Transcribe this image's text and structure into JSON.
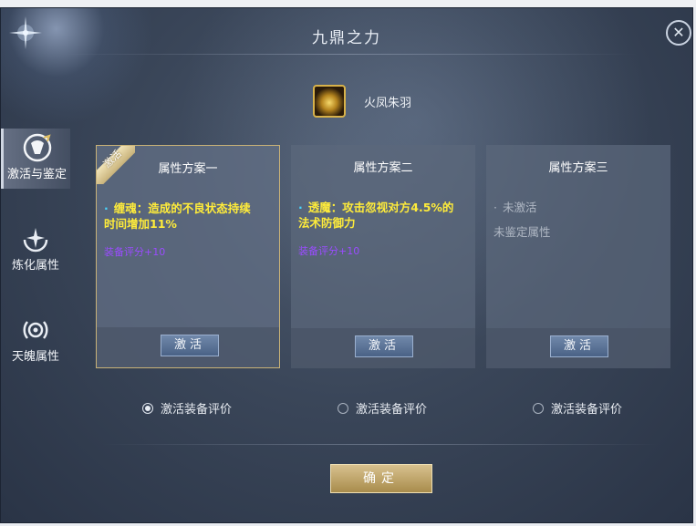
{
  "window": {
    "title": "九鼎之力"
  },
  "sidebar": {
    "items": [
      {
        "label": "激活与鉴定",
        "icon": "scroll-emblem-icon",
        "active": true
      },
      {
        "label": "炼化属性",
        "icon": "sparkle-crescent-icon",
        "active": false
      },
      {
        "label": "天魄属性",
        "icon": "eye-emblem-icon",
        "active": false
      }
    ]
  },
  "character": {
    "name": "火凤朱羽",
    "icon": "skull-portrait-icon"
  },
  "cards": [
    {
      "title": "属性方案一",
      "badge": "激活",
      "attr_line1": "缠魂：造成的不良状态持续",
      "attr_line2": "时间增加11%",
      "rating": "装备评分+10",
      "button": "激活"
    },
    {
      "title": "属性方案二",
      "attr_line1": "透魔：攻击忽视对方4.5%的",
      "attr_line2": "法术防御力",
      "rating": "装备评分+10",
      "button": "激活"
    },
    {
      "title": "属性方案三",
      "status": "未激活",
      "note": "未鉴定属性",
      "button": "激活"
    }
  ],
  "radios": [
    {
      "label": "激活装备评价",
      "checked": true
    },
    {
      "label": "激活装备评价",
      "checked": false
    },
    {
      "label": "激活装备评价",
      "checked": false
    }
  ],
  "confirm": {
    "label": "确定"
  },
  "close_symbol": "✕",
  "colors": {
    "attribute": "#ffec3a",
    "rating": "#9a4cff",
    "bullet": "#48d6ff",
    "gold_button": "#c8ad6e",
    "blue_button": "#5a7298"
  }
}
